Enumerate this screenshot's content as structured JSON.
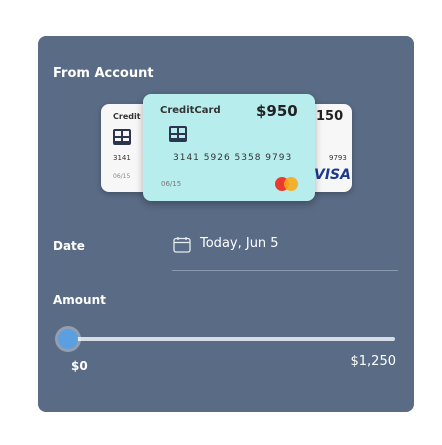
{
  "header": {
    "title": "From Account"
  },
  "cards": {
    "back_left": {
      "label": "Credit",
      "number_fragment": "3141",
      "expiry_fragment": "06/15"
    },
    "front": {
      "label": "CreditCard",
      "balance": "$950",
      "number": "3141 5926 5358 9793",
      "expiry": "06/15",
      "brand_icon": "mastercard-icon",
      "color": "#b7eded"
    },
    "back_right": {
      "balance_fragment": "150",
      "number_fragment": "9793",
      "brand": "VISA"
    }
  },
  "date_field": {
    "label": "Date",
    "value": "Today, Jun 5",
    "icon": "calendar-icon"
  },
  "amount": {
    "label": "Amount",
    "min_label": "$0",
    "max_label": "$1,250",
    "slider_value": 0
  },
  "colors": {
    "panel": "#5a6b86",
    "accent": "#5b9fe0",
    "mastercard_red": "#eb3b2f",
    "mastercard_yellow": "#f7a81b"
  }
}
